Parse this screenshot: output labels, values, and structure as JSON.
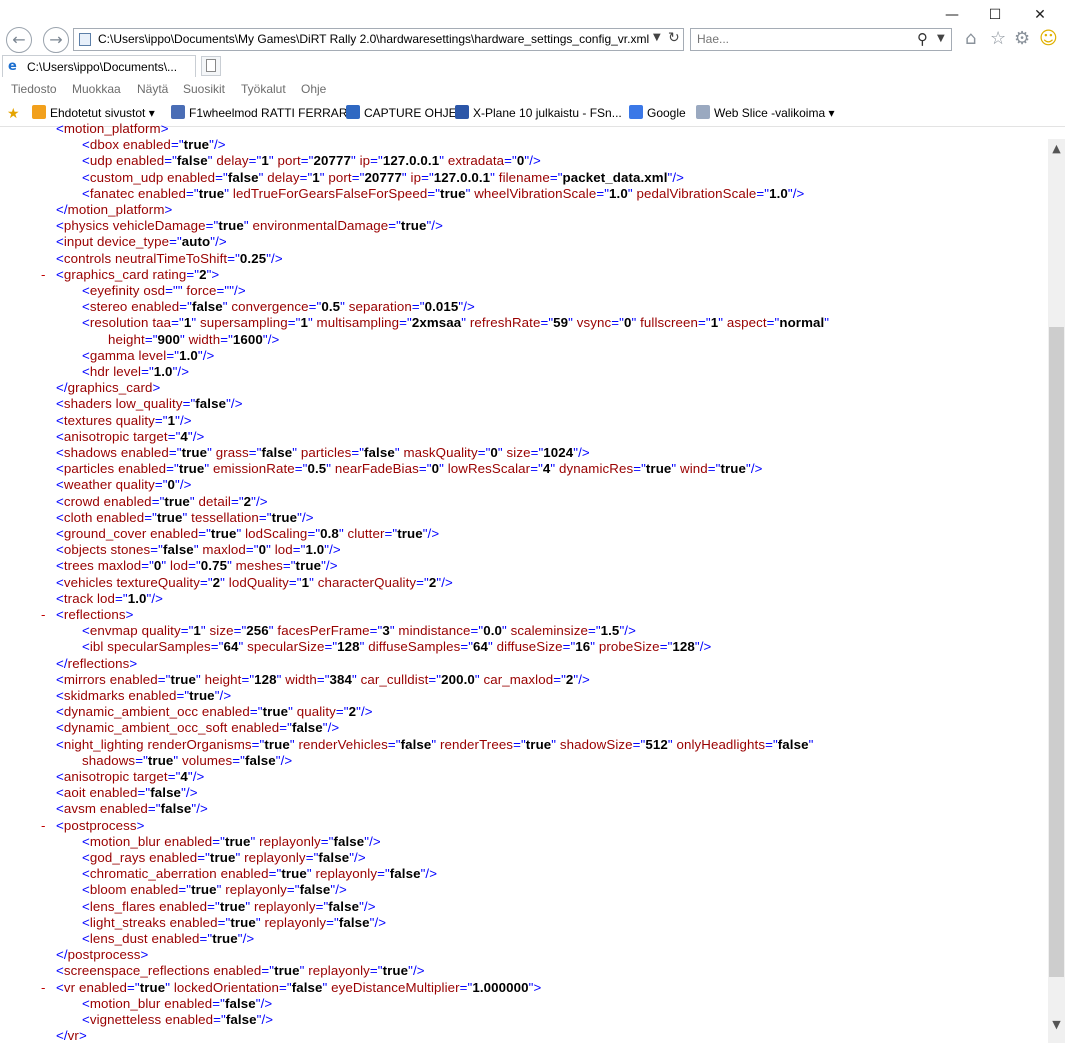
{
  "window": {
    "controls": {
      "minimize": "—",
      "maximize": "☐",
      "close": "✕"
    }
  },
  "address_bar": {
    "url": "C:\\Users\\ippo\\Documents\\My Games\\DiRT Rally 2.0\\hardwaresettings\\hardware_settings_config_vr.xml",
    "search_placeholder": "Hae..."
  },
  "toolbar_icons": [
    "home-icon",
    "star-icon",
    "gear-icon",
    "smiley-icon"
  ],
  "tab": {
    "label": "C:\\Users\\ippo\\Documents\\..."
  },
  "menu": [
    "Tiedosto",
    "Muokkaa",
    "Näytä",
    "Suosikit",
    "Työkalut",
    "Ohje"
  ],
  "favorites": [
    {
      "label": "Ehdotetut sivustot ▾",
      "color": "#f2a01c"
    },
    {
      "label": "F1wheelmod RATTI FERRARI",
      "color": "#4a6db5"
    },
    {
      "label": "CAPTURE OHJE",
      "color": "#2f68c2"
    },
    {
      "label": "X-Plane 10 julkaistu - FSn...",
      "color": "#2b56a8"
    },
    {
      "label": "Google",
      "color": "#3b78e7"
    },
    {
      "label": "Web Slice -valikoima ▾",
      "color": "#9aa9c0"
    }
  ],
  "xml_lines": [
    {
      "indent": 1,
      "text": "<motion_platform>",
      "marker": ""
    },
    {
      "indent": 2,
      "text": "<dbox enabled=\"true\"/>"
    },
    {
      "indent": 2,
      "text": "<udp enabled=\"false\" delay=\"1\" port=\"20777\" ip=\"127.0.0.1\" extradata=\"0\"/>"
    },
    {
      "indent": 2,
      "text": "<custom_udp enabled=\"false\" delay=\"1\" port=\"20777\" ip=\"127.0.0.1\" filename=\"packet_data.xml\"/>"
    },
    {
      "indent": 2,
      "text": "<fanatec enabled=\"true\" ledTrueForGearsFalseForSpeed=\"true\" wheelVibrationScale=\"1.0\" pedalVibrationScale=\"1.0\"/>"
    },
    {
      "indent": 1,
      "text": "</motion_platform>"
    },
    {
      "indent": 1,
      "text": "<physics vehicleDamage=\"true\" environmentalDamage=\"true\"/>"
    },
    {
      "indent": 1,
      "text": "<input device_type=\"auto\"/>"
    },
    {
      "indent": 1,
      "text": "<controls neutralTimeToShift=\"0.25\"/>"
    },
    {
      "indent": 1,
      "text": "<graphics_card rating=\"2\">",
      "marker": "-"
    },
    {
      "indent": 2,
      "text": "<eyefinity osd=\"\" force=\"\"/>"
    },
    {
      "indent": 2,
      "text": "<stereo enabled=\"false\" convergence=\"0.5\" separation=\"0.015\"/>"
    },
    {
      "indent": 2,
      "text": "<resolution taa=\"1\" supersampling=\"1\" multisampling=\"2xmsaa\" refreshRate=\"59\" vsync=\"0\" fullscreen=\"1\" aspect=\"normal\""
    },
    {
      "indent": 3,
      "text": "height=\"900\" width=\"1600\"/>"
    },
    {
      "indent": 2,
      "text": "<gamma level=\"1.0\"/>"
    },
    {
      "indent": 2,
      "text": "<hdr level=\"1.0\"/>"
    },
    {
      "indent": 1,
      "text": "</graphics_card>"
    },
    {
      "indent": 1,
      "text": "<shaders low_quality=\"false\"/>"
    },
    {
      "indent": 1,
      "text": "<textures quality=\"1\"/>"
    },
    {
      "indent": 1,
      "text": "<anisotropic target=\"4\"/>"
    },
    {
      "indent": 1,
      "text": "<shadows enabled=\"true\" grass=\"false\" particles=\"false\" maskQuality=\"0\" size=\"1024\"/>"
    },
    {
      "indent": 1,
      "text": "<particles enabled=\"true\" emissionRate=\"0.5\" nearFadeBias=\"0\" lowResScalar=\"4\" dynamicRes=\"true\" wind=\"true\"/>"
    },
    {
      "indent": 1,
      "text": "<weather quality=\"0\"/>"
    },
    {
      "indent": 1,
      "text": "<crowd enabled=\"true\" detail=\"2\"/>"
    },
    {
      "indent": 1,
      "text": "<cloth enabled=\"true\" tessellation=\"true\"/>"
    },
    {
      "indent": 1,
      "text": "<ground_cover enabled=\"true\" lodScaling=\"0.8\" clutter=\"true\"/>"
    },
    {
      "indent": 1,
      "text": "<objects stones=\"false\" maxlod=\"0\" lod=\"1.0\"/>"
    },
    {
      "indent": 1,
      "text": "<trees maxlod=\"0\" lod=\"0.75\" meshes=\"true\"/>"
    },
    {
      "indent": 1,
      "text": "<vehicles textureQuality=\"2\" lodQuality=\"1\" characterQuality=\"2\"/>"
    },
    {
      "indent": 1,
      "text": "<track lod=\"1.0\"/>"
    },
    {
      "indent": 1,
      "text": "<reflections>",
      "marker": "-"
    },
    {
      "indent": 2,
      "text": "<envmap quality=\"1\" size=\"256\" facesPerFrame=\"3\" mindistance=\"0.0\" scaleminsize=\"1.5\"/>"
    },
    {
      "indent": 2,
      "text": "<ibl specularSamples=\"64\" specularSize=\"128\" diffuseSamples=\"64\" diffuseSize=\"16\" probeSize=\"128\"/>"
    },
    {
      "indent": 1,
      "text": "</reflections>"
    },
    {
      "indent": 1,
      "text": "<mirrors enabled=\"true\" height=\"128\" width=\"384\" car_culldist=\"200.0\" car_maxlod=\"2\"/>"
    },
    {
      "indent": 1,
      "text": "<skidmarks enabled=\"true\"/>"
    },
    {
      "indent": 1,
      "text": "<dynamic_ambient_occ enabled=\"true\" quality=\"2\"/>"
    },
    {
      "indent": 1,
      "text": "<dynamic_ambient_occ_soft enabled=\"false\"/>"
    },
    {
      "indent": 1,
      "text": "<night_lighting renderOrganisms=\"true\" renderVehicles=\"false\" renderTrees=\"true\" shadowSize=\"512\" onlyHeadlights=\"false\""
    },
    {
      "indent": 2,
      "text": "shadows=\"true\" volumes=\"false\"/>"
    },
    {
      "indent": 1,
      "text": "<anisotropic target=\"4\"/>"
    },
    {
      "indent": 1,
      "text": "<aoit enabled=\"false\"/>"
    },
    {
      "indent": 1,
      "text": "<avsm enabled=\"false\"/>"
    },
    {
      "indent": 1,
      "text": "<postprocess>",
      "marker": "-"
    },
    {
      "indent": 2,
      "text": "<motion_blur enabled=\"true\" replayonly=\"false\"/>"
    },
    {
      "indent": 2,
      "text": "<god_rays enabled=\"true\" replayonly=\"false\"/>"
    },
    {
      "indent": 2,
      "text": "<chromatic_aberration enabled=\"true\" replayonly=\"false\"/>"
    },
    {
      "indent": 2,
      "text": "<bloom enabled=\"true\" replayonly=\"false\"/>"
    },
    {
      "indent": 2,
      "text": "<lens_flares enabled=\"true\" replayonly=\"false\"/>"
    },
    {
      "indent": 2,
      "text": "<light_streaks enabled=\"true\" replayonly=\"false\"/>"
    },
    {
      "indent": 2,
      "text": "<lens_dust enabled=\"true\"/>"
    },
    {
      "indent": 1,
      "text": "</postprocess>"
    },
    {
      "indent": 1,
      "text": "<screenspace_reflections enabled=\"true\" replayonly=\"true\"/>"
    },
    {
      "indent": 1,
      "text": "<vr enabled=\"true\" lockedOrientation=\"false\" eyeDistanceMultiplier=\"1.000000\">",
      "marker": "-"
    },
    {
      "indent": 2,
      "text": "<motion_blur enabled=\"false\"/>"
    },
    {
      "indent": 2,
      "text": "<vignetteless enabled=\"false\"/>"
    },
    {
      "indent": 1,
      "text": "</vr>"
    }
  ]
}
